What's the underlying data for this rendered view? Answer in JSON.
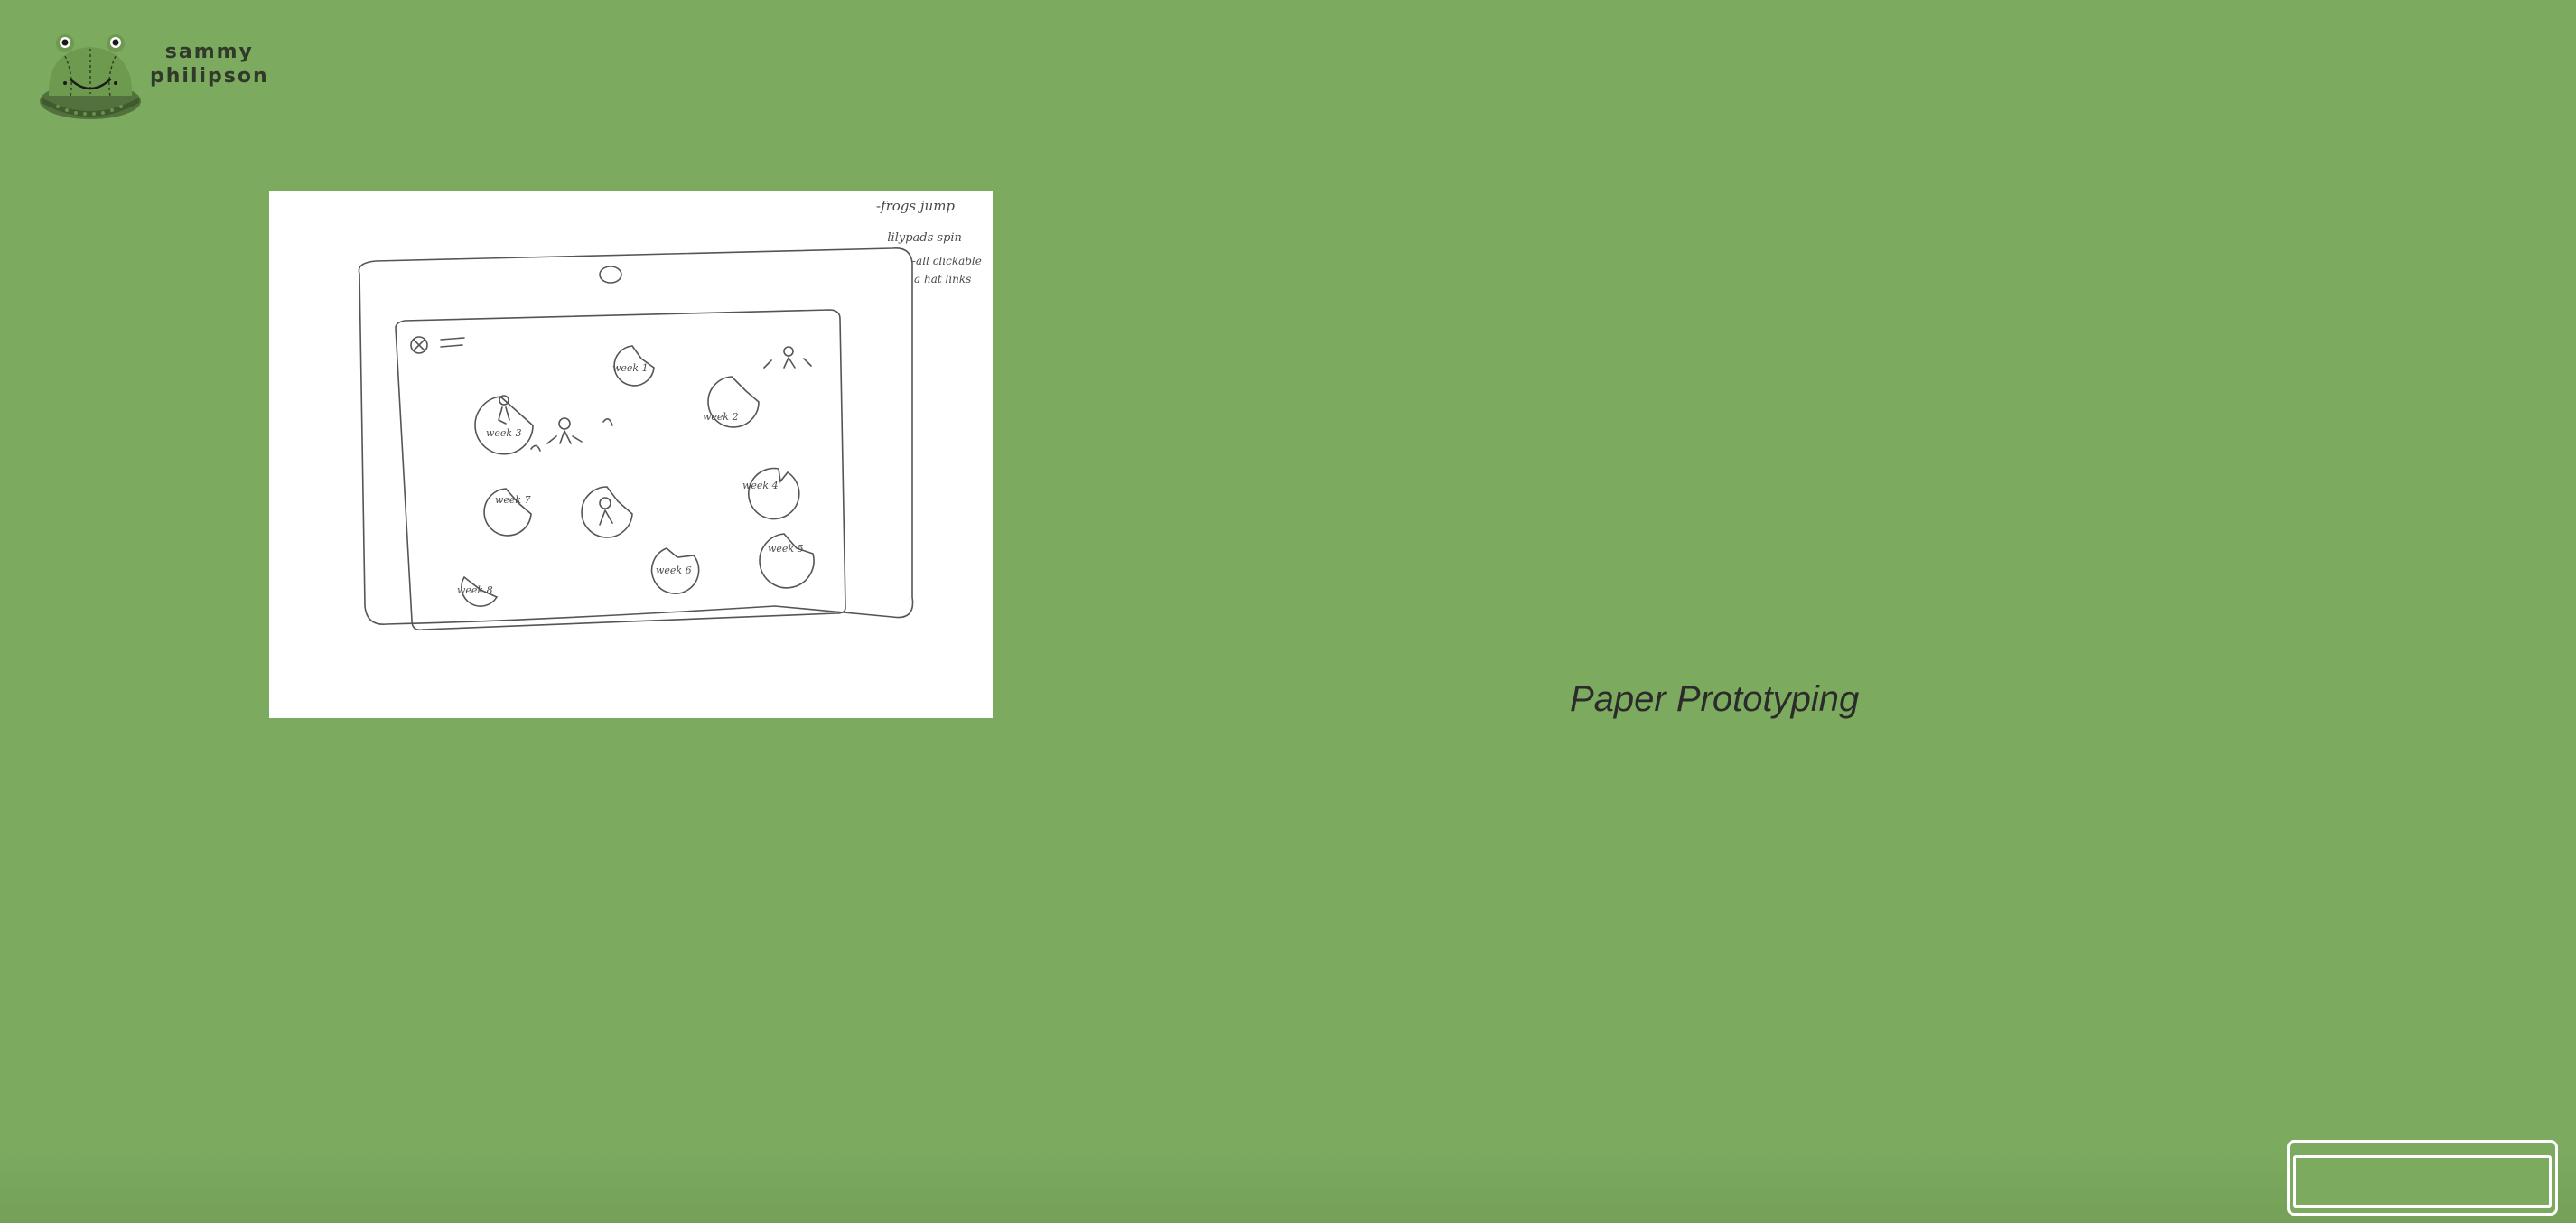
{
  "logo": {
    "name_line1": "sammy",
    "name_line2": "philipson",
    "icon": "frog-hat-icon"
  },
  "sketch": {
    "icon": "paper-prototype-sketch",
    "notes": [
      "-frogs jump",
      "-lilypads spin",
      "-all clickable",
      "a hat links"
    ],
    "lilypads": [
      "week 1",
      "week 2",
      "week 3",
      "week 4",
      "week 5",
      "week 6",
      "week 7",
      "week 8"
    ]
  },
  "main": {
    "caption": "Paper Prototyping"
  },
  "colors": {
    "background": "#7caa5f",
    "text": "#2b2b2b"
  }
}
